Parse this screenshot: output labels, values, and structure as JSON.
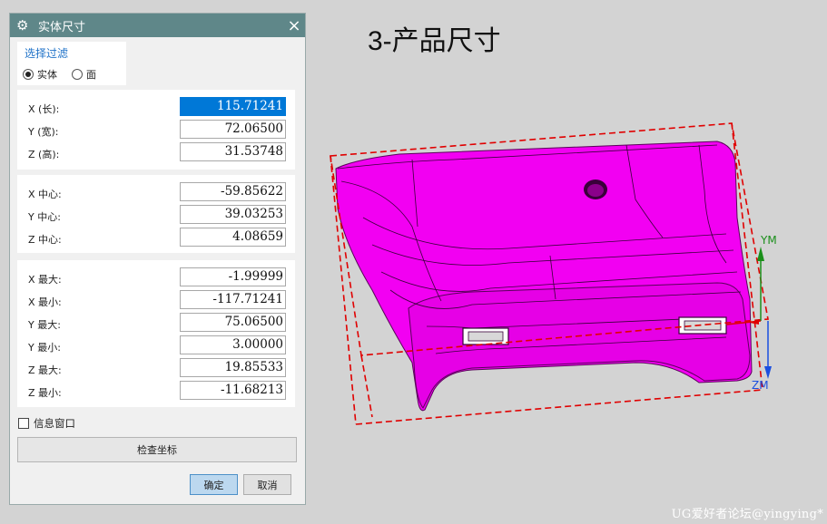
{
  "dialog": {
    "title": "实体尺寸",
    "close_label": "×",
    "icons": {
      "settings": "gear-icon",
      "close": "close-icon"
    },
    "filter": {
      "title": "选择过滤",
      "options": [
        {
          "label": "实体",
          "selected": true
        },
        {
          "label": "面",
          "selected": false
        }
      ]
    },
    "size_rows": [
      {
        "label": "X (长):",
        "value": "115.71241",
        "selected": true
      },
      {
        "label": "Y (宽):",
        "value": "72.06500"
      },
      {
        "label": "Z (高):",
        "value": "31.53748"
      }
    ],
    "center_rows": [
      {
        "label": "X 中心:",
        "value": "-59.85622"
      },
      {
        "label": "Y 中心:",
        "value": "39.03253"
      },
      {
        "label": "Z 中心:",
        "value": "4.08659"
      }
    ],
    "extent_rows": [
      {
        "label": "X 最大:",
        "value": "-1.99999"
      },
      {
        "label": "X 最小:",
        "value": "-117.71241"
      },
      {
        "label": "Y 最大:",
        "value": "75.06500"
      },
      {
        "label": "Y 最小:",
        "value": "3.00000"
      },
      {
        "label": "Z 最大:",
        "value": "19.85533"
      },
      {
        "label": "Z 最小:",
        "value": "-11.68213"
      }
    ],
    "info_window_label": "信息窗口",
    "info_window_checked": false,
    "check_coords_label": "检查坐标",
    "ok_label": "确定",
    "cancel_label": "取消"
  },
  "viewport": {
    "heading": "3-产品尺寸",
    "axis_y_label": "YM",
    "axis_z_label": "ZM",
    "part_color": "#ff00ff",
    "bbox_color": "#e00000"
  },
  "watermark": "UG爱好者论坛@yingying*"
}
